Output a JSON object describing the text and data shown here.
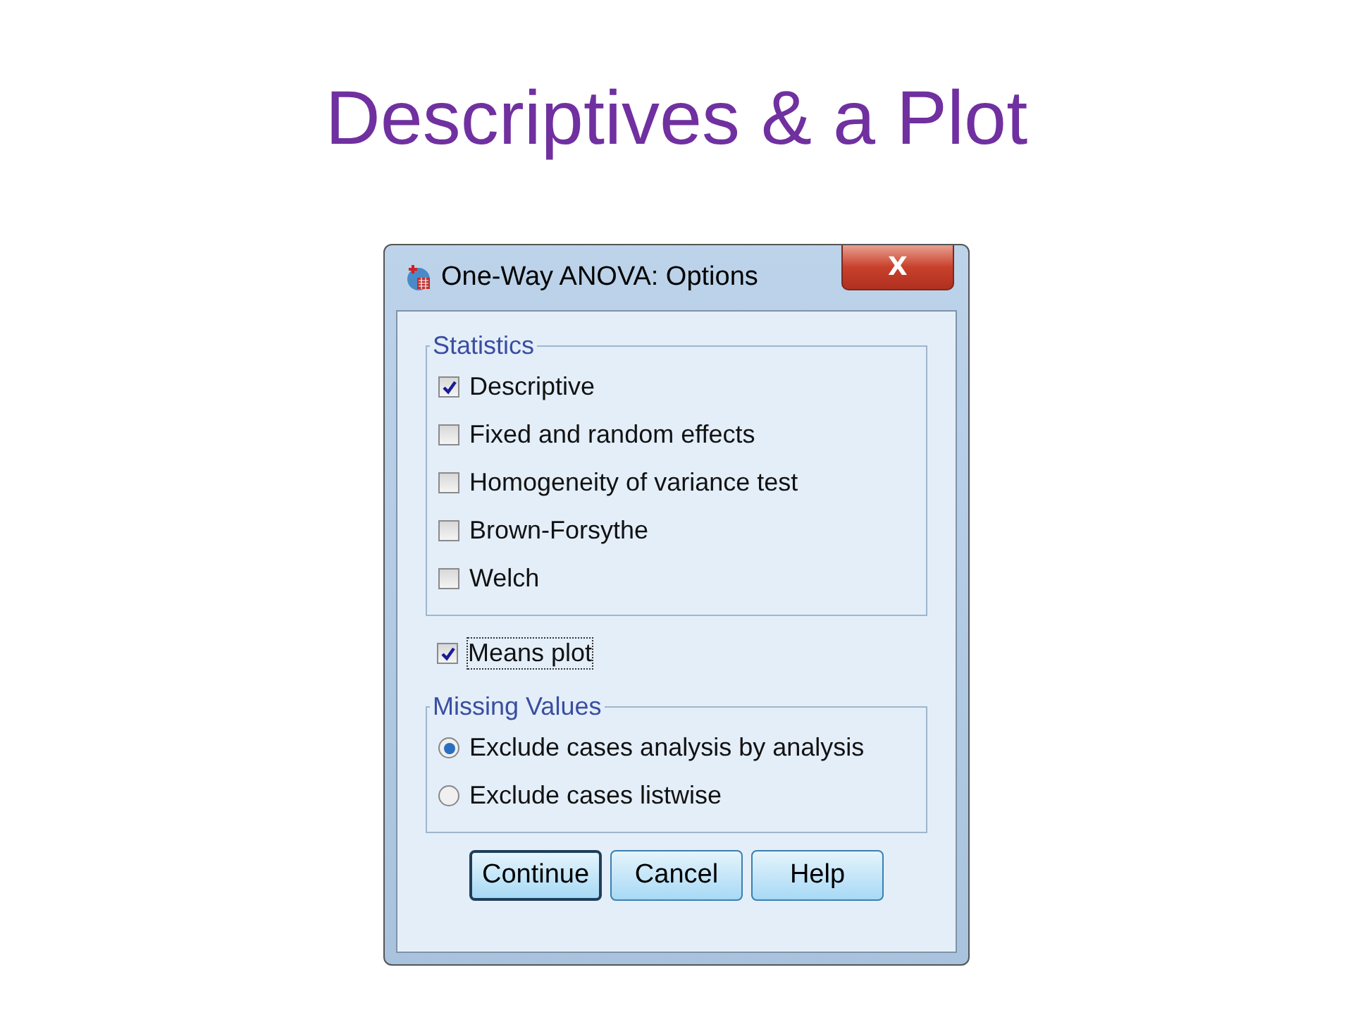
{
  "slide_title": "Descriptives & a Plot",
  "window": {
    "title": "One-Way ANOVA: Options",
    "close": "X"
  },
  "statistics": {
    "legend": "Statistics",
    "options": [
      {
        "label": "Descriptive",
        "checked": true
      },
      {
        "label": "Fixed and random effects",
        "checked": false
      },
      {
        "label": "Homogeneity of variance test",
        "checked": false
      },
      {
        "label": "Brown-Forsythe",
        "checked": false
      },
      {
        "label": "Welch",
        "checked": false
      }
    ]
  },
  "means_plot": {
    "label": "Means plot",
    "checked": true,
    "focused": true
  },
  "missing_values": {
    "legend": "Missing Values",
    "options": [
      {
        "label": "Exclude cases analysis by analysis",
        "selected": true
      },
      {
        "label": "Exclude cases listwise",
        "selected": false
      }
    ]
  },
  "buttons": [
    {
      "label": "Continue",
      "default": true
    },
    {
      "label": "Cancel",
      "default": false
    },
    {
      "label": "Help",
      "default": false
    }
  ]
}
